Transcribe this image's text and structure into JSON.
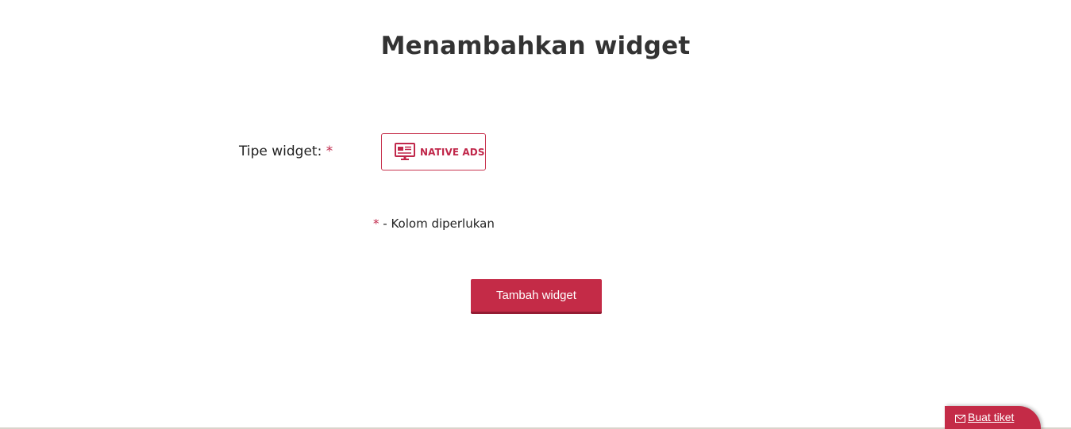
{
  "header": {
    "title": "Menambahkan widget"
  },
  "form": {
    "widget_type_label": "Tipe widget:",
    "required_star": "*",
    "widget_type_options": [
      {
        "label": "NATIVE ADS",
        "icon": "native-ads-monitor-icon"
      }
    ],
    "required_note": "- Kolom diperlukan",
    "submit_label": "Tambah widget"
  },
  "support": {
    "ticket_label": "Buat tiket",
    "icon": "envelope-icon"
  },
  "colors": {
    "accent": "#c42b47",
    "accent_dark": "#941c33",
    "text": "#333333"
  }
}
